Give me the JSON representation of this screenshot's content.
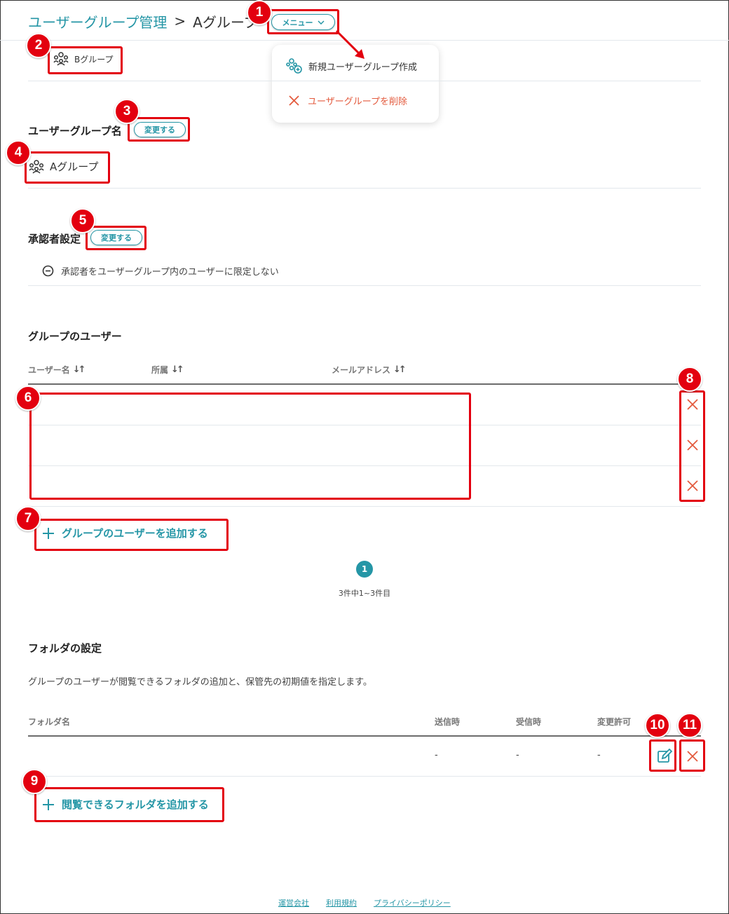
{
  "breadcrumb": {
    "parent": "ユーザーグループ管理",
    "separator": ">",
    "current": "Aグループ"
  },
  "menu_button": {
    "label": "メニュー"
  },
  "menu_dropdown": {
    "items": [
      {
        "label": "新規ユーザーグループ作成",
        "icon": "group-add-icon"
      },
      {
        "label": "ユーザーグループを削除",
        "icon": "close-icon"
      }
    ]
  },
  "parent_group": {
    "label": "Bグループ",
    "icon": "group-icon"
  },
  "group_name_section": {
    "title": "ユーザーグループ名",
    "change_label": "変更する",
    "value": "Aグループ"
  },
  "approver_section": {
    "title": "承認者設定",
    "change_label": "変更する",
    "setting_text": "承認者をユーザーグループ内のユーザーに限定しない"
  },
  "group_users_section": {
    "title": "グループのユーザー",
    "columns": [
      "ユーザー名",
      "所属",
      "メールアドレス"
    ],
    "rows": [
      {
        "name": "",
        "dept": "",
        "email": ""
      },
      {
        "name": "",
        "dept": "",
        "email": ""
      },
      {
        "name": "",
        "dept": "",
        "email": ""
      }
    ],
    "add_label": "グループのユーザーを追加する",
    "pagination": {
      "current_page": "1",
      "summary": "3件中1~3件目"
    }
  },
  "folder_section": {
    "title": "フォルダの設定",
    "description": "グループのユーザーが閲覧できるフォルダの追加と、保管先の初期値を指定します。",
    "columns": [
      "フォルダ名",
      "送信時",
      "受信時",
      "変更許可"
    ],
    "rows": [
      {
        "name": "",
        "send": "-",
        "receive": "-",
        "permission": "-"
      }
    ],
    "add_label": "閲覧できるフォルダを追加する"
  },
  "annotations": [
    "1",
    "2",
    "3",
    "4",
    "5",
    "6",
    "7",
    "8",
    "9",
    "10",
    "11"
  ],
  "footer": {
    "links": [
      "運営会社",
      "利用規約",
      "プライバシーポリシー"
    ]
  },
  "colors": {
    "accent": "#2596a6",
    "danger": "#e35a3d",
    "annotation": "#e3000f"
  }
}
